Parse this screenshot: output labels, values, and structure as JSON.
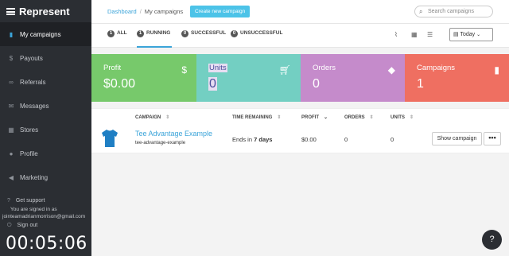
{
  "sidebar": {
    "brand": "Represent",
    "items": [
      {
        "label": "My campaigns",
        "icon": "bar-chart-icon",
        "glyph": "▮"
      },
      {
        "label": "Payouts",
        "icon": "dollar-icon",
        "glyph": "$"
      },
      {
        "label": "Referrals",
        "icon": "link-icon",
        "glyph": "∞"
      },
      {
        "label": "Messages",
        "icon": "envelope-icon",
        "glyph": "✉"
      },
      {
        "label": "Stores",
        "icon": "grid-icon",
        "glyph": "▦"
      },
      {
        "label": "Profile",
        "icon": "user-icon",
        "glyph": "●"
      },
      {
        "label": "Marketing",
        "icon": "megaphone-icon",
        "glyph": "◀"
      }
    ],
    "support_label": "Get support",
    "signed_in_label": "You are signed in as",
    "signed_in_email": "jointeamadrianmorrison@gmail.com",
    "signout_label": "Sign out",
    "timer": "00:05:06"
  },
  "topbar": {
    "breadcrumb_link": "Dashboard",
    "breadcrumb_sep": "/",
    "breadcrumb_current": "My campaigns",
    "new_campaign_label": "Create new campaign",
    "search_placeholder": "Search campaigns"
  },
  "tabs": {
    "all": {
      "count": "1",
      "label": "ALL"
    },
    "running": {
      "count": "1",
      "label": "RUNNING"
    },
    "successful": {
      "count": "0",
      "label": "SUCCESSFUL"
    },
    "unsuccessful": {
      "count": "0",
      "label": "UNSUCCESSFUL"
    },
    "date_filter": "Today"
  },
  "stats": {
    "profit": {
      "label": "Profit",
      "value": "$0.00",
      "color": "#77c96b"
    },
    "units": {
      "label": "Units",
      "value": "0",
      "color": "#73cfc2"
    },
    "orders": {
      "label": "Orders",
      "value": "0",
      "color": "#c58bcb"
    },
    "campaigns": {
      "label": "Campaigns",
      "value": "1",
      "color": "#ef6f61"
    }
  },
  "table": {
    "headers": {
      "campaign": "CAMPAIGN",
      "time": "TIME REMAINING",
      "profit": "PROFIT",
      "orders": "ORDERS",
      "units": "UNITS"
    },
    "row": {
      "name": "Tee Advantage Example",
      "slug": "tee-advantage-example",
      "time_prefix": "Ends in",
      "time_value": "7 days",
      "profit": "$0.00",
      "orders": "0",
      "units": "0",
      "show_label": "Show campaign",
      "more_label": "•••"
    }
  },
  "help_label": "?"
}
